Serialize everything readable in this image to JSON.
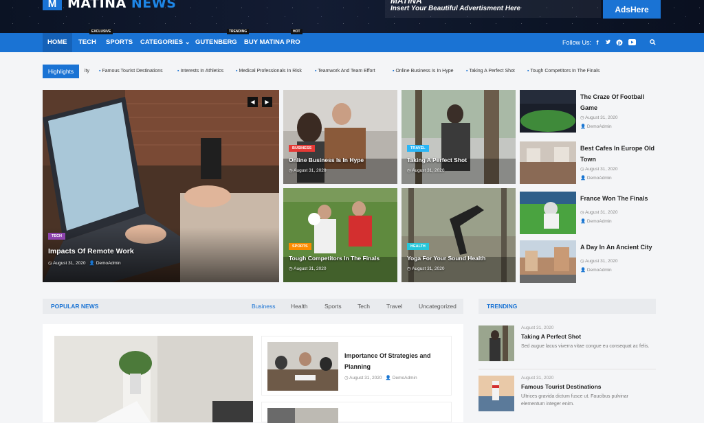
{
  "header": {
    "logo_text": "MATINA",
    "logo_text_accent": "NEWS",
    "logo_mark": "M",
    "ad_title": "MATINA",
    "ad_text": "Insert Your Beautiful Advertisment Here",
    "ad_button": "AdsHere"
  },
  "nav": {
    "items": [
      {
        "label": "HOME",
        "tag": ""
      },
      {
        "label": "TECH",
        "tag": "EXCLUSIVE"
      },
      {
        "label": "SPORTS",
        "tag": ""
      },
      {
        "label": "CATEGORIES",
        "tag": ""
      },
      {
        "label": "GUTENBERG",
        "tag": "TRENDING"
      },
      {
        "label": "BUY MATINA PRO",
        "tag": "HOT"
      }
    ],
    "follow_label": "Follow Us:",
    "social_icons": [
      "facebook-icon",
      "twitter-icon",
      "pinterest-icon",
      "youtube-icon"
    ]
  },
  "ticker": {
    "label": "Highlights",
    "items": [
      "ity",
      "Famous Tourist Destinations",
      "Interests In Athletics",
      "Medical Professionals In Risk",
      "Teamwork And Team Effort",
      "Online Business Is In Hype",
      "Taking A Perfect Shot",
      "Tough Competitors In The Finals"
    ]
  },
  "hero": {
    "main": {
      "badge": "TECH",
      "title": "Impacts Of Remote Work",
      "date": "August 31, 2020",
      "author": "DemoAdmin"
    },
    "grid": [
      {
        "badge": "BUSINESS",
        "title": "Online Business Is In Hype",
        "date": "August 31, 2020",
        "badge_color": "#e53935"
      },
      {
        "badge": "TRAVEL",
        "title": "Taking A Perfect Shot",
        "date": "August 31, 2020",
        "badge_color": "#29b6f6"
      },
      {
        "badge": "SPORTS",
        "title": "Tough Competitors In The Finals",
        "date": "August 31, 2020",
        "badge_color": "#fb8c00"
      },
      {
        "badge": "HEALTH",
        "title": "Yoga For Your Sound Health",
        "date": "August 31, 2020",
        "badge_color": "#26c6da"
      }
    ],
    "side": [
      {
        "title": "The Craze Of Football Game",
        "date": "August 31, 2020",
        "author": "DemoAdmin"
      },
      {
        "title": "Best Cafes In Europe Old Town",
        "date": "August 31, 2020",
        "author": "DemoAdmin"
      },
      {
        "title": "France Won The Finals",
        "date": "August 31, 2020",
        "author": "DemoAdmin"
      },
      {
        "title": "A Day In An Ancient City",
        "date": "August 31, 2020",
        "author": "DemoAdmin"
      }
    ]
  },
  "popular": {
    "title": "POPULAR NEWS",
    "tabs": [
      "Business",
      "Health",
      "Sports",
      "Tech",
      "Travel",
      "Uncategorized"
    ],
    "rows": [
      {
        "title": "Importance Of Strategies and Planning",
        "date": "August 31, 2020",
        "author": "DemoAdmin"
      }
    ]
  },
  "trending": {
    "title": "TRENDING",
    "items": [
      {
        "date": "August 31, 2020",
        "title": "Taking A Perfect Shot",
        "excerpt": "Sed augue lacus viverra vitae congue eu consequat ac felis."
      },
      {
        "date": "August 31, 2020",
        "title": "Famous Tourist Destinations",
        "excerpt": "Ultrices gravida dictum fusce ut. Faucibus pulvinar elementum integer enim."
      }
    ]
  },
  "colors": {
    "brand": "#1a73d4",
    "nav_active": "#1561b7"
  }
}
